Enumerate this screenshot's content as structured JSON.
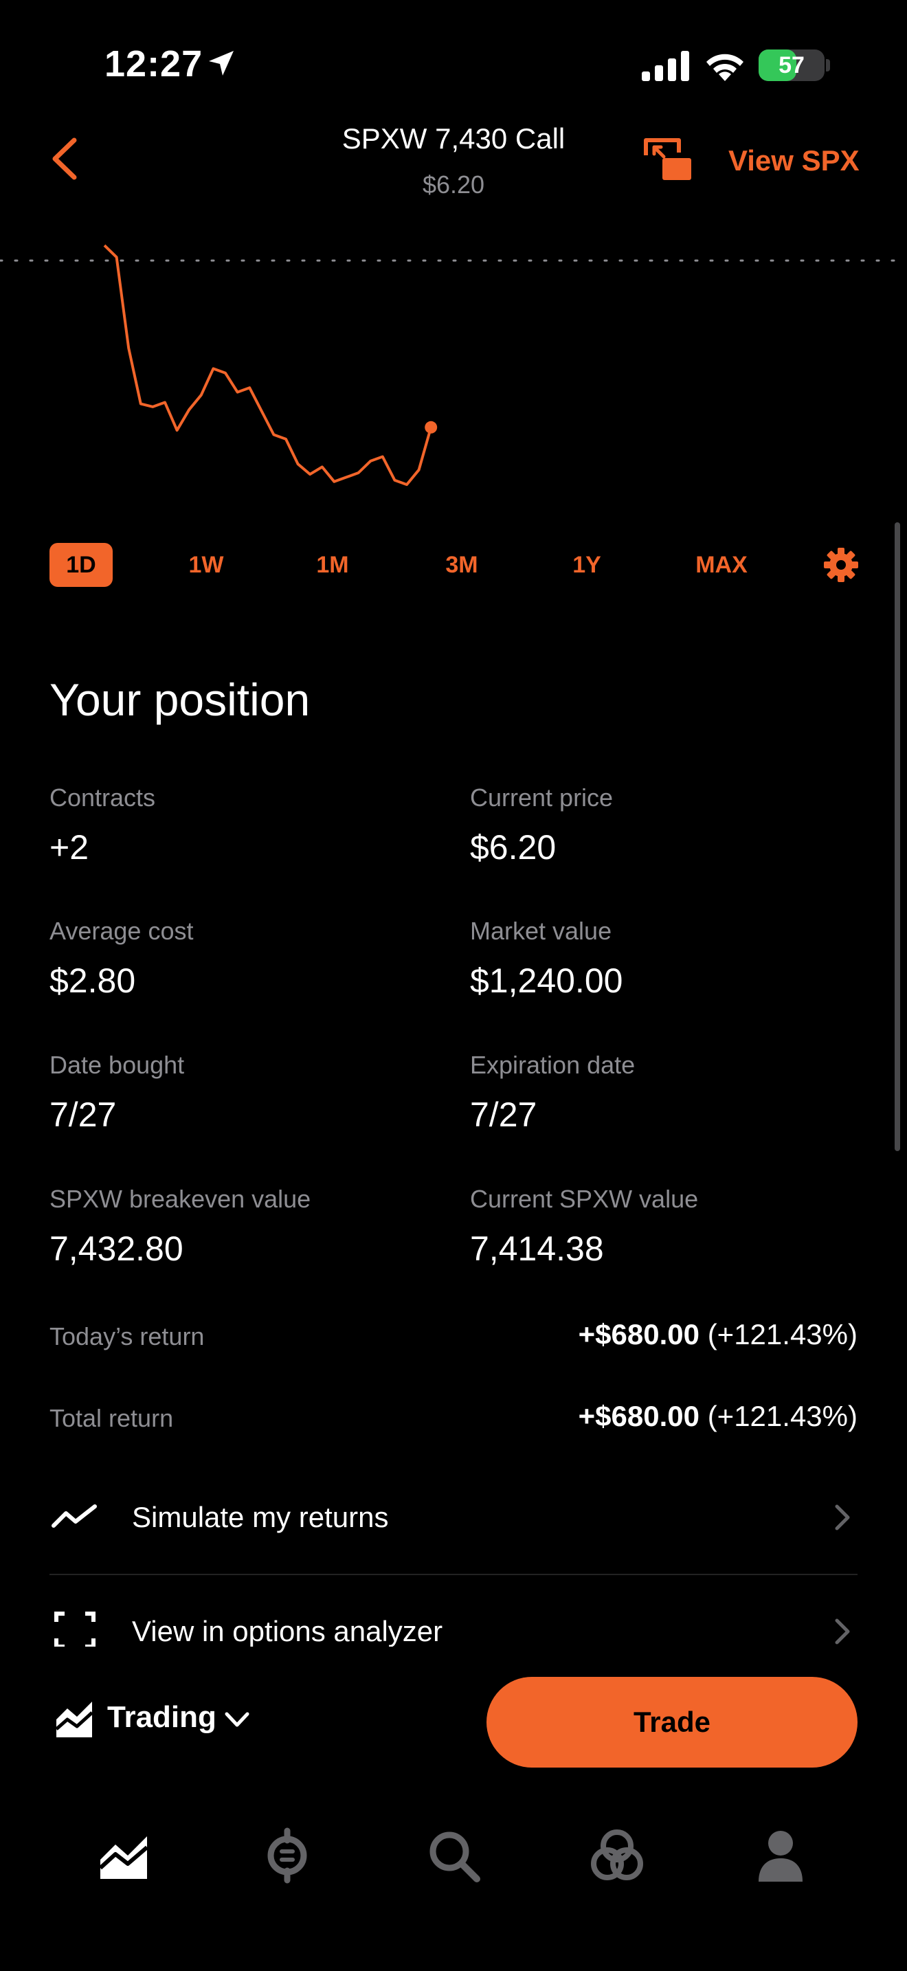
{
  "status_bar": {
    "time": "12:27",
    "battery_percent": "57",
    "battery_level": 0.57
  },
  "header": {
    "title": "SPXW 7,430 Call",
    "subtitle": "$6.20",
    "view_link": "View SPX"
  },
  "chart_data": {
    "type": "line",
    "color": "#f2652a",
    "points": [
      [
        0,
        45.0
      ],
      [
        1,
        44.2
      ],
      [
        2,
        38.0
      ],
      [
        3,
        34.2
      ],
      [
        4,
        34.0
      ],
      [
        5,
        34.3
      ],
      [
        6,
        32.4
      ],
      [
        7,
        33.8
      ],
      [
        8,
        34.8
      ],
      [
        9,
        36.6
      ],
      [
        10,
        36.3
      ],
      [
        11,
        35.0
      ],
      [
        12,
        35.3
      ],
      [
        13,
        33.7
      ],
      [
        14,
        32.1
      ],
      [
        15,
        31.8
      ],
      [
        16,
        30.1
      ],
      [
        17,
        29.4
      ],
      [
        18,
        29.9
      ],
      [
        19,
        28.9
      ],
      [
        20,
        29.2
      ],
      [
        21,
        29.5
      ],
      [
        22,
        30.3
      ],
      [
        23,
        30.6
      ],
      [
        24,
        29.0
      ],
      [
        25,
        28.7
      ],
      [
        26,
        29.7
      ],
      [
        27,
        32.6
      ]
    ],
    "reference_line": 45.0,
    "last_point_marker": true,
    "grid": false
  },
  "timeframes": {
    "items": [
      {
        "label": "1D",
        "active": true
      },
      {
        "label": "1W",
        "active": false
      },
      {
        "label": "1M",
        "active": false
      },
      {
        "label": "3M",
        "active": false
      },
      {
        "label": "1Y",
        "active": false
      },
      {
        "label": "MAX",
        "active": false
      }
    ]
  },
  "position": {
    "title": "Your position",
    "contracts_label": "Contracts",
    "contracts_value": "+2",
    "current_price_label": "Current price",
    "current_price_value": "$6.20",
    "avg_cost_label": "Average cost",
    "avg_cost_value": "$2.80",
    "market_value_label": "Market value",
    "market_value_value": "$1,240.00",
    "date_bought_label": "Date bought",
    "date_bought_value": "7/27",
    "expiration_label": "Expiration date",
    "expiration_value": "7/27",
    "breakeven_label": "SPXW breakeven value",
    "breakeven_value": "7,432.80",
    "current_spxw_label": "Current SPXW value",
    "current_spxw_value": "7,414.38",
    "today_return_label": "Today’s return",
    "today_return_amount": "+$680.00",
    "today_return_pct": "(+121.43%)",
    "total_return_label": "Total return",
    "total_return_amount": "+$680.00",
    "total_return_pct": "(+121.43%)"
  },
  "actions": {
    "simulate": "Simulate my returns",
    "analyzer": "View in options analyzer"
  },
  "trading_bar": {
    "mode_label": "Trading",
    "trade_button": "Trade"
  },
  "colors": {
    "accent": "#f2652a",
    "secondary_text": "#8e8e93",
    "background": "#000000"
  },
  "tab_bar": {
    "icons": [
      "investing-icon",
      "crypto-icon",
      "search-icon",
      "network-icon",
      "account-icon"
    ],
    "active_index": 0
  }
}
